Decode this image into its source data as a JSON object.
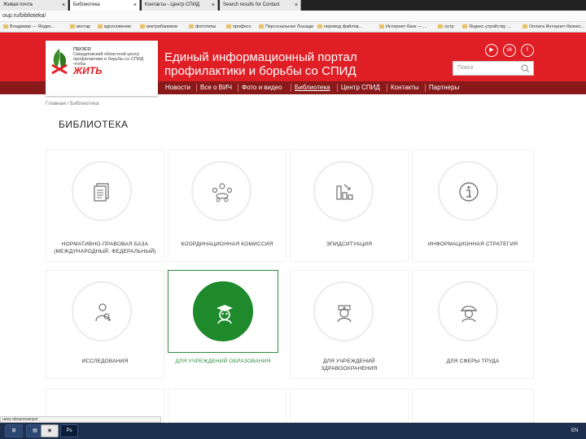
{
  "browser": {
    "tabs": [
      {
        "title": "Живая почта"
      },
      {
        "title": "Библиотека"
      },
      {
        "title": "Контакты - Центр СПИД"
      },
      {
        "title": "Search results for Contact"
      }
    ],
    "address": "oup.ru/biblioteka/",
    "bookmarks": [
      "Владимир — Яндек...",
      "вестар",
      "вдохновение",
      "вектрибанивов",
      "фототипы",
      "професо",
      "Персональная Лошади",
      "перевод файлов...",
      "Интернет-банк — ...",
      "лутр",
      "Яндекс утройству ...",
      "Оплата Интернет-бизнес..."
    ],
    "status_url": "uzey-obrazovaniya/"
  },
  "header": {
    "logo_line1": "ГБУЗСО",
    "logo_line2": "Свердловский областной центр",
    "logo_line3": "профилактики и борьбы со СПИД",
    "logo_slogan_small": "чтобы",
    "logo_slogan_big": "ЖИТЬ",
    "title_line1": "Единый информационный портал",
    "title_line2": "профилактики и борьбы со СПИД",
    "search_placeholder": "Поиск",
    "social": [
      "youtube-icon",
      "vk-icon",
      "facebook-icon"
    ]
  },
  "nav": [
    "Новости",
    "Все о ВИЧ",
    "Фото и видео",
    "Библиотека",
    "Центр СПИД",
    "Контакты",
    "Партнеры"
  ],
  "breadcrumb": "Главная / Библиотека",
  "page_title": "БИБЛИОТЕКА",
  "cards": [
    {
      "label": "НОРМАТИВНО-ПРАВОВАЯ БАЗА (МЕЖДУНАРОДНЫЙ, ФЕДЕРАЛЬНЫЙ)",
      "icon": "document-icon"
    },
    {
      "label": "КООРДИНАЦИОННАЯ КОМИССИЯ",
      "icon": "meeting-icon"
    },
    {
      "label": "ЭПИДСИТУАЦИЯ",
      "icon": "chart-icon"
    },
    {
      "label": "ИНФОРМАЦИОННАЯ СТРАТЕГИЯ",
      "icon": "info-icon"
    },
    {
      "label": "ИССЛЕДОВАНИЯ",
      "icon": "research-icon"
    },
    {
      "label": "ДЛЯ УЧРЕЖДЕНИЙ ОБРАЗОВАНИЯ",
      "icon": "graduate-icon",
      "selected": true
    },
    {
      "label": "ДЛЯ УЧРЕЖДЕНИЙ ЗДРАВООХРАНЕНИЯ",
      "icon": "nurse-icon"
    },
    {
      "label": "ДЛЯ СФЕРЫ ТРУДА",
      "icon": "worker-icon"
    }
  ],
  "taskbar": {
    "lang": "EN"
  }
}
